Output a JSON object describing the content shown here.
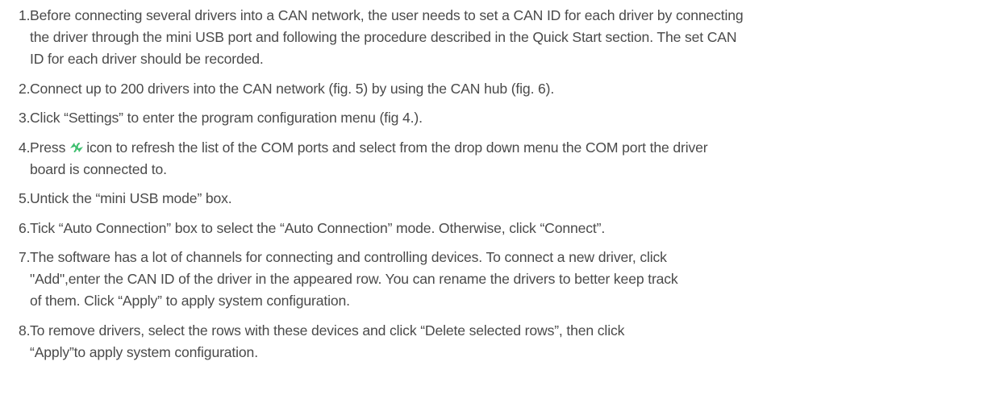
{
  "steps": [
    {
      "number": "1.",
      "lines": [
        "Before connecting several drivers into a CAN network, the user needs to set a CAN ID for each driver by connecting",
        "the driver through the mini USB port and following the procedure described in the Quick Start section. The set CAN",
        "ID for each driver should be recorded."
      ]
    },
    {
      "number": "2.",
      "lines": [
        "Connect up to 200 drivers into the CAN network (fig. 5) by using the CAN hub (fig. 6)."
      ]
    },
    {
      "number": "3.",
      "lines": [
        "Click “Settings” to enter the program configuration menu (fig 4.)."
      ]
    },
    {
      "number": "4.",
      "line1_before_icon": "Press",
      "line1_after_icon": "icon to refresh the list of the COM ports and select from the drop down menu the COM port the driver",
      "line2": "board is connected to.",
      "icon": "refresh-icon",
      "icon_color": "#3fbf6f"
    },
    {
      "number": "5.",
      "lines": [
        "Untick the “mini USB mode” box."
      ]
    },
    {
      "number": "6.",
      "lines": [
        "Tick “Auto Connection” box to select the “Auto Connection” mode. Otherwise, click “Connect”."
      ]
    },
    {
      "number": "7.",
      "lines": [
        "The software has a lot of channels for connecting and controlling devices. To connect a new driver, click",
        "\"Add\",enter the CAN ID of the driver in the appeared row. You can rename the drivers to better keep track",
        "of them. Click “Apply” to apply system configuration."
      ]
    },
    {
      "number": "8.",
      "lines": [
        "To remove drivers, select the rows with these devices and click “Delete selected rows”, then click",
        "“Apply”to apply system configuration."
      ]
    }
  ]
}
